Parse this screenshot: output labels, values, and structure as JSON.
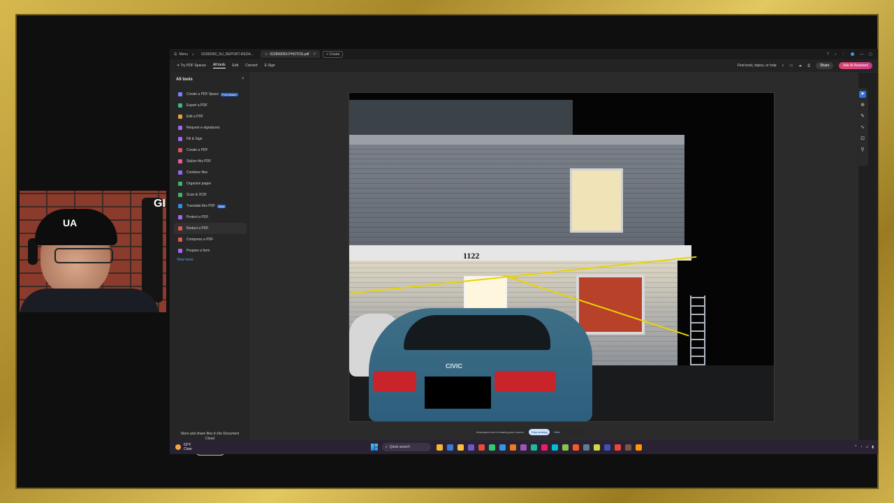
{
  "titlebar": {
    "menu_label": "Menu",
    "tabs": [
      {
        "label": "02280050_SU_REPORT-REDA...",
        "active": false
      },
      {
        "label": "022800050-PHOTOS.pdf",
        "active": true
      }
    ],
    "create_label": "+ Create"
  },
  "toolbar": {
    "try_label": "Try PDF Spaces",
    "items": [
      "All tools",
      "Edit",
      "Convert",
      "E-Sign"
    ],
    "find_label": "Find tools, topics, or help",
    "share_label": "Share",
    "ask_label": "Ask AI Assistant"
  },
  "sidebar": {
    "title": "All tools",
    "tools": [
      {
        "label": "Create a PDF Space",
        "badge": "Full version",
        "color": "#7c7cff"
      },
      {
        "label": "Export a PDF",
        "badge": "",
        "color": "#3bb58b"
      },
      {
        "label": "Edit a PDF",
        "badge": "",
        "color": "#e0a33a"
      },
      {
        "label": "Request e-signatures",
        "badge": "",
        "color": "#a167f0"
      },
      {
        "label": "Fill & Sign",
        "badge": "",
        "color": "#a167f0"
      },
      {
        "label": "Create a PDF",
        "badge": "",
        "color": "#e35454"
      },
      {
        "label": "Stylize this PDF",
        "badge": "",
        "color": "#e35d9a"
      },
      {
        "label": "Combine files",
        "badge": "",
        "color": "#8f6af0"
      },
      {
        "label": "Organize pages",
        "badge": "",
        "color": "#3fb36f"
      },
      {
        "label": "Scan & OCR",
        "badge": "",
        "color": "#3fb36f"
      },
      {
        "label": "Translate this PDF",
        "badge": "New",
        "color": "#2f8fe8"
      },
      {
        "label": "Protect a PDF",
        "badge": "",
        "color": "#a167f0"
      },
      {
        "label": "Redact a PDF",
        "badge": "",
        "color": "#e35454"
      },
      {
        "label": "Compress a PDF",
        "badge": "",
        "color": "#e35454"
      },
      {
        "label": "Prepare a form",
        "badge": "",
        "color": "#a167f0"
      }
    ],
    "active_index": 12,
    "view_more": "View more",
    "store_text": "Store and share files in the Document Cloud",
    "learn_more": "Learn More"
  },
  "photo": {
    "address_number": "1122",
    "car_model": "CIVIC"
  },
  "screen_share": {
    "message": "drawnpard.com is sharing your screen.",
    "stop_label": "Stop sharing",
    "hide_label": "Hide"
  },
  "taskbar": {
    "temp": "63°F",
    "condition": "Clear",
    "search_placeholder": "Quick search"
  },
  "webcam": {
    "cap_logo": "UA",
    "wall_logo": "GI"
  }
}
